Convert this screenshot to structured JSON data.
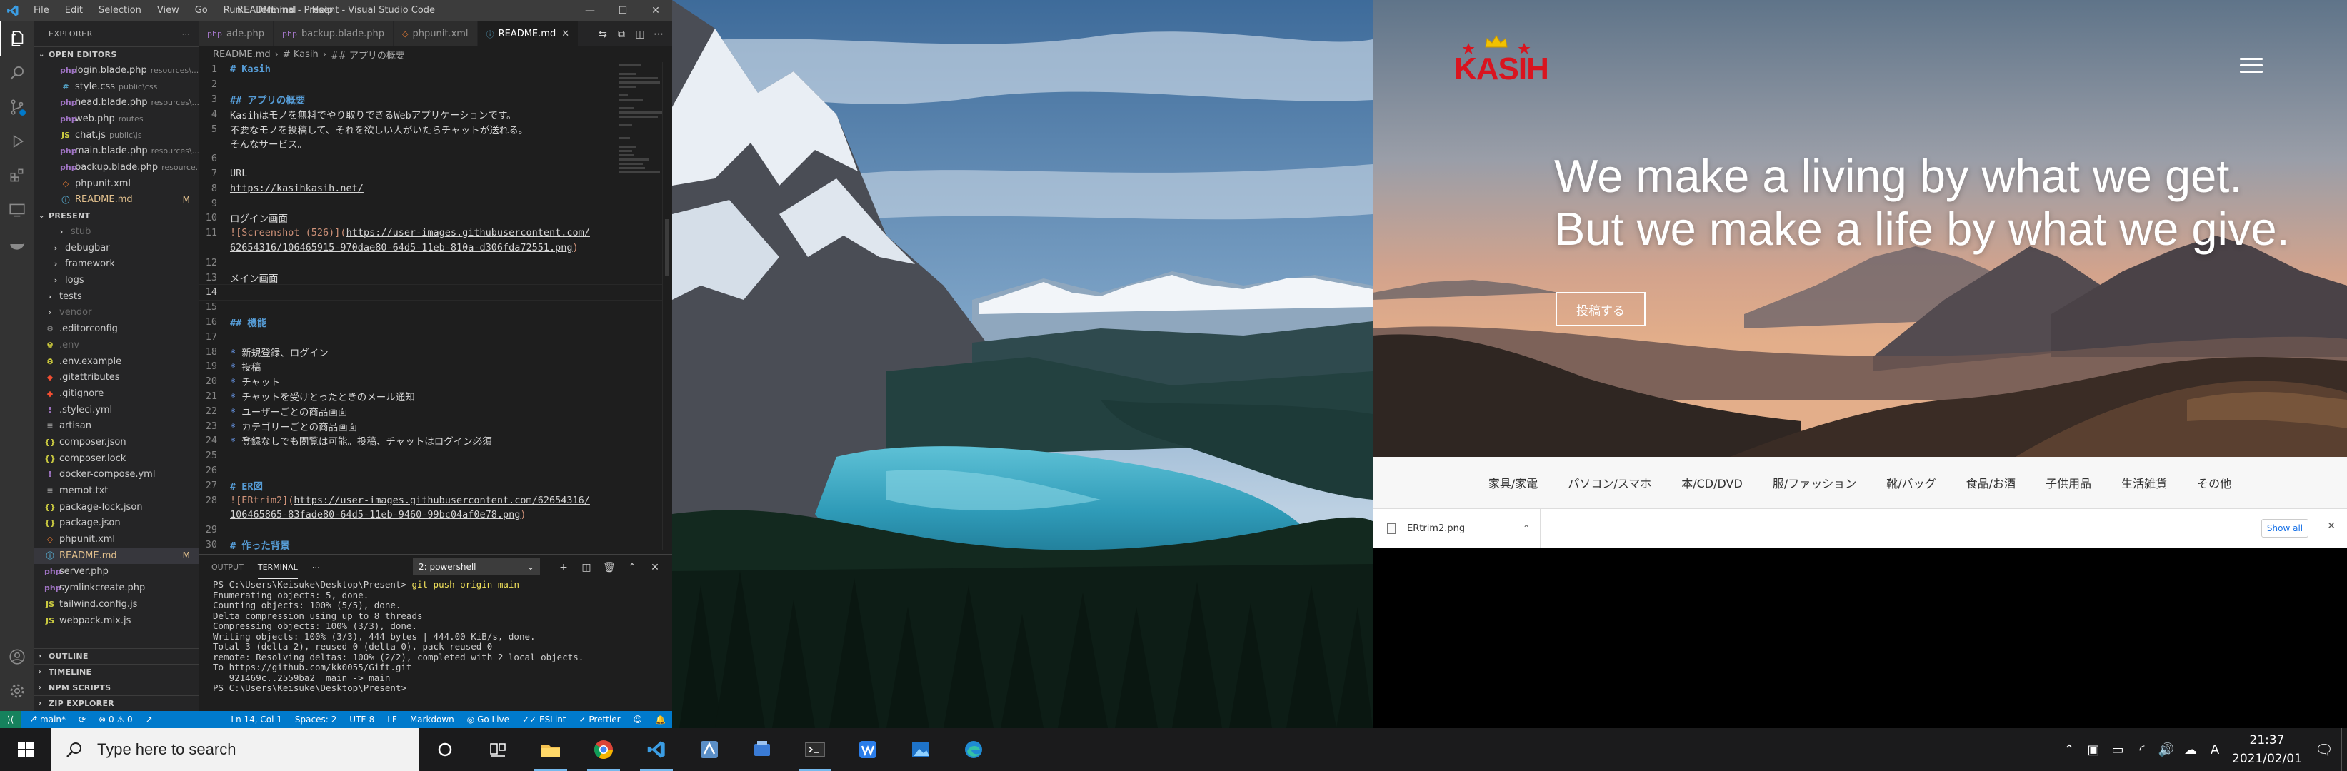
{
  "vscode": {
    "window_title": "README.md - Present - Visual Studio Code",
    "menu": [
      "File",
      "Edit",
      "Selection",
      "View",
      "Go",
      "Run",
      "Terminal",
      "Help"
    ],
    "sidebar_title": "EXPLORER",
    "open_editors_label": "OPEN EDITORS",
    "open_editors": [
      {
        "name": "login.blade.php",
        "desc": "resources\\...",
        "icon": "php"
      },
      {
        "name": "style.css",
        "desc": "public\\css",
        "icon": "css"
      },
      {
        "name": "head.blade.php",
        "desc": "resources\\...",
        "icon": "php"
      },
      {
        "name": "web.php",
        "desc": "routes",
        "icon": "php"
      },
      {
        "name": "chat.js",
        "desc": "public\\js",
        "icon": "js"
      },
      {
        "name": "main.blade.php",
        "desc": "resources\\...",
        "icon": "php"
      },
      {
        "name": "backup.blade.php",
        "desc": "resource...",
        "icon": "php"
      },
      {
        "name": "phpunit.xml",
        "desc": "",
        "icon": "xml"
      },
      {
        "name": "README.md",
        "desc": "",
        "icon": "md",
        "badge": "M"
      }
    ],
    "project_label": "PRESENT",
    "project_items": [
      {
        "name": "stub",
        "indent": 2,
        "folder": true
      },
      {
        "name": "debugbar",
        "indent": 1,
        "folder": true
      },
      {
        "name": "framework",
        "indent": 1,
        "folder": true
      },
      {
        "name": "logs",
        "indent": 1,
        "folder": true
      },
      {
        "name": "tests",
        "indent": 0,
        "folder": true
      },
      {
        "name": "vendor",
        "indent": 0,
        "folder": true
      },
      {
        "name": ".editorconfig",
        "indent": 0,
        "icon": "cfg"
      },
      {
        "name": ".env",
        "indent": 0,
        "icon": "env"
      },
      {
        "name": ".env.example",
        "indent": 0,
        "icon": "env"
      },
      {
        "name": ".gitattributes",
        "indent": 0,
        "icon": "git"
      },
      {
        "name": ".gitignore",
        "indent": 0,
        "icon": "git"
      },
      {
        "name": ".styleci.yml",
        "indent": 0,
        "icon": "yml"
      },
      {
        "name": "artisan",
        "indent": 0,
        "icon": "txt"
      },
      {
        "name": "composer.json",
        "indent": 0,
        "icon": "json"
      },
      {
        "name": "composer.lock",
        "indent": 0,
        "icon": "json"
      },
      {
        "name": "docker-compose.yml",
        "indent": 0,
        "icon": "yml"
      },
      {
        "name": "memot.txt",
        "indent": 0,
        "icon": "txt"
      },
      {
        "name": "package-lock.json",
        "indent": 0,
        "icon": "json"
      },
      {
        "name": "package.json",
        "indent": 0,
        "icon": "json"
      },
      {
        "name": "phpunit.xml",
        "indent": 0,
        "icon": "xml"
      },
      {
        "name": "README.md",
        "indent": 0,
        "icon": "md",
        "badge": "M",
        "selected": true
      },
      {
        "name": "server.php",
        "indent": 0,
        "icon": "php"
      },
      {
        "name": "symlinkcreate.php",
        "indent": 0,
        "icon": "php"
      },
      {
        "name": "tailwind.config.js",
        "indent": 0,
        "icon": "js"
      },
      {
        "name": "webpack.mix.js",
        "indent": 0,
        "icon": "js"
      }
    ],
    "bottom_sections": [
      "OUTLINE",
      "TIMELINE",
      "NPM SCRIPTS",
      "ZIP EXPLORER"
    ],
    "tabs": [
      {
        "label": "ade.php",
        "icon": "php"
      },
      {
        "label": "backup.blade.php",
        "icon": "php"
      },
      {
        "label": "phpunit.xml",
        "icon": "xml"
      },
      {
        "label": "README.md",
        "icon": "md",
        "active": true
      }
    ],
    "breadcrumb": [
      "README.md",
      "#  Kasih",
      "##  アプリの概要"
    ],
    "code_lines": [
      {
        "n": "1",
        "parts": [
          {
            "c": "h",
            "t": "# Kasih"
          }
        ]
      },
      {
        "n": "2",
        "parts": []
      },
      {
        "n": "3",
        "parts": [
          {
            "c": "h",
            "t": "## アプリの概要"
          }
        ]
      },
      {
        "n": "4",
        "parts": [
          {
            "c": "ct",
            "t": "Kasihはモノを無料でやり取りできるWebアプリケーションです。"
          }
        ]
      },
      {
        "n": "5",
        "parts": [
          {
            "c": "ct",
            "t": "不要なモノを投稿して、それを欲しい人がいたらチャットが送れる。"
          }
        ]
      },
      {
        "n": "",
        "parts": [
          {
            "c": "ct",
            "t": "そんなサービス。"
          }
        ]
      },
      {
        "n": "6",
        "parts": []
      },
      {
        "n": "7",
        "parts": [
          {
            "c": "ct",
            "t": "URL"
          }
        ]
      },
      {
        "n": "8",
        "parts": [
          {
            "c": "url",
            "t": "https://kasihkasih.net/"
          }
        ]
      },
      {
        "n": "9",
        "parts": []
      },
      {
        "n": "10",
        "parts": [
          {
            "c": "ct",
            "t": "ログイン画面"
          }
        ]
      },
      {
        "n": "11",
        "parts": [
          {
            "c": "lnk",
            "t": "![Screenshot (526)]("
          },
          {
            "c": "url",
            "t": "https://user-images.githubusercontent.com/"
          }
        ]
      },
      {
        "n": "",
        "parts": [
          {
            "c": "url",
            "t": "62654316/106465915-970dae80-64d5-11eb-810a-d306fda72551.png"
          },
          {
            "c": "lnk",
            "t": ")"
          }
        ]
      },
      {
        "n": "12",
        "parts": []
      },
      {
        "n": "13",
        "parts": [
          {
            "c": "ct",
            "t": "メイン画面"
          }
        ]
      },
      {
        "n": "14",
        "parts": [],
        "current": true
      },
      {
        "n": "15",
        "parts": []
      },
      {
        "n": "16",
        "parts": [
          {
            "c": "h",
            "t": "## 機能"
          }
        ]
      },
      {
        "n": "17",
        "parts": []
      },
      {
        "n": "18",
        "parts": [
          {
            "c": "bul",
            "t": "* "
          },
          {
            "c": "ct",
            "t": "新規登録、ログイン"
          }
        ]
      },
      {
        "n": "19",
        "parts": [
          {
            "c": "bul",
            "t": "* "
          },
          {
            "c": "ct",
            "t": "投稿"
          }
        ]
      },
      {
        "n": "20",
        "parts": [
          {
            "c": "bul",
            "t": "* "
          },
          {
            "c": "ct",
            "t": "チャット"
          }
        ]
      },
      {
        "n": "21",
        "parts": [
          {
            "c": "bul",
            "t": "* "
          },
          {
            "c": "ct",
            "t": "チャットを受けとったときのメール通知"
          }
        ]
      },
      {
        "n": "22",
        "parts": [
          {
            "c": "bul",
            "t": "* "
          },
          {
            "c": "ct",
            "t": "ユーザーごとの商品画面"
          }
        ]
      },
      {
        "n": "23",
        "parts": [
          {
            "c": "bul",
            "t": "* "
          },
          {
            "c": "ct",
            "t": "カテゴリーごとの商品画面"
          }
        ]
      },
      {
        "n": "24",
        "parts": [
          {
            "c": "bul",
            "t": "* "
          },
          {
            "c": "ct",
            "t": "登録なしでも閲覧は可能。投稿、チャットはログイン必須"
          }
        ]
      },
      {
        "n": "25",
        "parts": []
      },
      {
        "n": "26",
        "parts": []
      },
      {
        "n": "27",
        "parts": [
          {
            "c": "h",
            "t": "# ER図"
          }
        ]
      },
      {
        "n": "28",
        "parts": [
          {
            "c": "lnk",
            "t": "![ERtrim2]("
          },
          {
            "c": "url",
            "t": "https://user-images.githubusercontent.com/62654316/"
          }
        ]
      },
      {
        "n": "",
        "parts": [
          {
            "c": "url",
            "t": "106465865-83fade80-64d5-11eb-9460-99bc04af0e78.png"
          },
          {
            "c": "lnk",
            "t": ")"
          }
        ]
      },
      {
        "n": "29",
        "parts": []
      },
      {
        "n": "30",
        "parts": [
          {
            "c": "h",
            "t": "# 作った背景"
          }
        ]
      }
    ],
    "panel_tabs": [
      "OUTPUT",
      "TERMINAL"
    ],
    "terminal_select": "2: powershell",
    "terminal_lines": [
      {
        "prompt": "PS C:\\Users\\Keisuke\\Desktop\\Present> ",
        "cmd": "git push origin main"
      },
      {
        "text": "Enumerating objects: 5, done."
      },
      {
        "text": "Counting objects: 100% (5/5), done."
      },
      {
        "text": "Delta compression using up to 8 threads"
      },
      {
        "text": "Compressing objects: 100% (3/3), done."
      },
      {
        "text": "Writing objects: 100% (3/3), 444 bytes | 444.00 KiB/s, done."
      },
      {
        "text": "Total 3 (delta 2), reused 0 (delta 0), pack-reused 0"
      },
      {
        "text": "remote: Resolving deltas: 100% (2/2), completed with 2 local objects."
      },
      {
        "text": "To https://github.com/kk0055/Gift.git"
      },
      {
        "text": "   921469c..2559ba2  main -> main"
      },
      {
        "prompt": "PS C:\\Users\\Keisuke\\Desktop\\Present> ",
        "cmd": ""
      }
    ],
    "status": {
      "branch": "main*",
      "sync": "⟳",
      "problems": "⊗ 0  ⚠ 0",
      "position": "Ln 14, Col 1",
      "spaces": "Spaces: 2",
      "encoding": "UTF-8",
      "eol": "LF",
      "language": "Markdown",
      "golive": "Go Live",
      "eslint": "ESLint",
      "prettier": "Prettier"
    }
  },
  "browser": {
    "logo_text": "KASIH",
    "hero_line1": "We make a living by what we get.",
    "hero_line2": "But we make a life by what we give.",
    "post_button": "投稿する",
    "categories": [
      "家具/家電",
      "パソコン/スマホ",
      "本/CD/DVD",
      "服/ファッション",
      "靴/バッグ",
      "食品/お酒",
      "子供用品",
      "生活雑貨",
      "その他"
    ],
    "download_file": "ERtrim2.png",
    "show_all": "Show all",
    "colors": {
      "logo": "#d9141f",
      "crown": "#f2c200"
    }
  },
  "taskbar": {
    "search_placeholder": "Type here to search",
    "time": "21:37",
    "date": "2021/02/01",
    "ime": "A",
    "apps": [
      "cortana-icon",
      "task-view-icon",
      "file-explorer-icon",
      "chrome-icon",
      "vscode-icon",
      "app-icon-1",
      "app-icon-2",
      "terminal-icon",
      "wps-icon",
      "photos-icon",
      "edge-icon"
    ]
  }
}
